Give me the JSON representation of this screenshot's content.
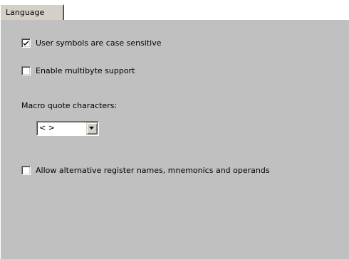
{
  "tab": {
    "label": "Language"
  },
  "options": {
    "case_sensitive": {
      "label": "User symbols are case sensitive",
      "checked": true
    },
    "multibyte": {
      "label": "Enable multibyte support",
      "checked": false
    },
    "alt_register": {
      "label": "Allow alternative register names, mnemonics and operands",
      "checked": false
    }
  },
  "macro_quote": {
    "label": "Macro quote characters:",
    "selected": "< >"
  },
  "icons": {
    "check": "check-icon",
    "dropdown": "chevron-down-icon"
  },
  "colors": {
    "panel_background": "#c0c0c0",
    "field_background": "#ffffff"
  }
}
